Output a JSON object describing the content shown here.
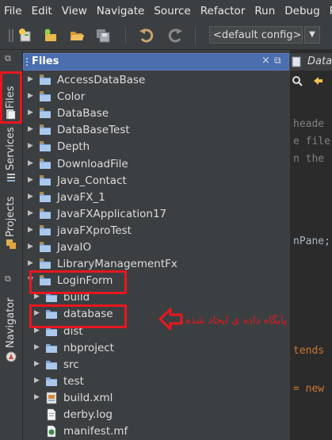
{
  "menu": [
    "File",
    "Edit",
    "View",
    "Navigate",
    "Source",
    "Refactor",
    "Run",
    "Debug",
    "Pr"
  ],
  "toolbar": {
    "config_value": "<default config>",
    "icons": [
      "new-project-icon",
      "new-file-icon",
      "open-project-icon",
      "save-all-icon",
      "undo-icon",
      "redo-icon"
    ]
  },
  "left_strip": {
    "tabs": [
      "Files",
      "Services",
      "Projects",
      "Navigator"
    ]
  },
  "files_panel": {
    "title": "Files",
    "close_glyph": "×",
    "tree": [
      {
        "label": "AccessDataBase",
        "type": "project",
        "arrow": "collapsed"
      },
      {
        "label": "Color",
        "type": "project",
        "arrow": "collapsed"
      },
      {
        "label": "DataBase",
        "type": "project",
        "arrow": "collapsed"
      },
      {
        "label": "DataBaseTest",
        "type": "project",
        "arrow": "collapsed"
      },
      {
        "label": "Depth",
        "type": "project",
        "arrow": "collapsed"
      },
      {
        "label": "DownloadFile",
        "type": "project",
        "arrow": "collapsed"
      },
      {
        "label": "Java_Contact",
        "type": "project",
        "arrow": "collapsed"
      },
      {
        "label": "JavaFX_1",
        "type": "project",
        "arrow": "collapsed"
      },
      {
        "label": "JavaFXApplication17",
        "type": "project",
        "arrow": "collapsed"
      },
      {
        "label": "javaFXproTest",
        "type": "project",
        "arrow": "collapsed"
      },
      {
        "label": "JavaIO",
        "type": "project",
        "arrow": "collapsed"
      },
      {
        "label": "LibraryManagementFx",
        "type": "project",
        "arrow": "collapsed"
      },
      {
        "label": "LoginForm",
        "type": "project",
        "arrow": "expanded"
      },
      {
        "label": "build",
        "type": "folder",
        "arrow": "collapsed"
      },
      {
        "label": "database",
        "type": "folder",
        "arrow": "collapsed"
      },
      {
        "label": "dist",
        "type": "folder",
        "arrow": "collapsed"
      },
      {
        "label": "nbproject",
        "type": "folder",
        "arrow": "collapsed"
      },
      {
        "label": "src",
        "type": "folder",
        "arrow": "collapsed"
      },
      {
        "label": "test",
        "type": "folder",
        "arrow": "collapsed"
      },
      {
        "label": "build.xml",
        "type": "xml",
        "arrow": "collapsed"
      },
      {
        "label": "derby.log",
        "type": "file",
        "arrow": "none"
      },
      {
        "label": "manifest.mf",
        "type": "manifest",
        "arrow": "none"
      }
    ]
  },
  "editor": {
    "tab_label": "Data",
    "lines": [
      {
        "text": "heade",
        "style": "comment"
      },
      {
        "text": "e file",
        "style": "comment"
      },
      {
        "text": "n the",
        "style": "comment"
      },
      {
        "text": "nPane;",
        "style": "txt"
      },
      {
        "text": "tends",
        "style": "kw"
      },
      {
        "text": "= new",
        "style": "kw"
      }
    ]
  },
  "annotation": {
    "text": "پایگاه داده ی ایجاد شده"
  },
  "colors": {
    "highlight_red": "#e8171f",
    "panel_header": "#4b6eaf",
    "folder": "#7fa7d6"
  }
}
